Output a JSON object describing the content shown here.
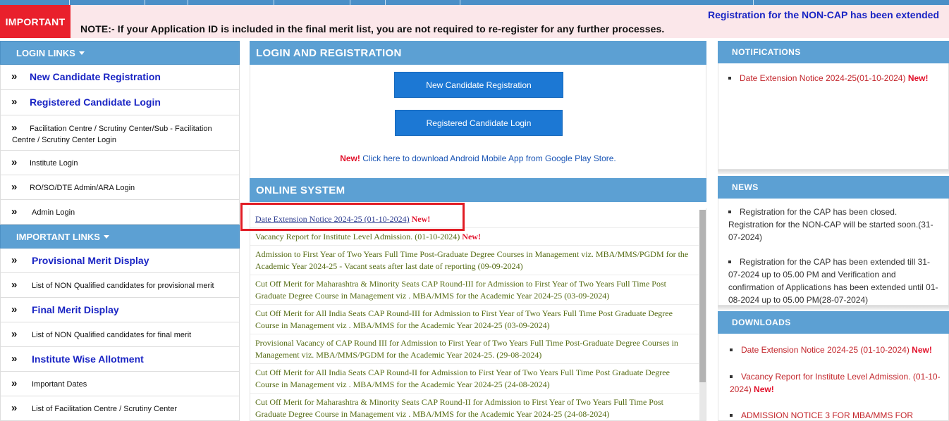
{
  "marquee_text": "Registration for the NON-CAP has been extended",
  "important_badge": "IMPORTANT",
  "note_text": "NOTE:- If your Application ID is included in the final merit list, you are not required to re-register for any further processes.",
  "login_links": {
    "heading": "LOGIN LINKS",
    "items": [
      "New Candidate Registration",
      "Registered Candidate Login",
      "Facilitation Centre / Scrutiny Center/Sub - Facilitation Centre / Scrutiny Center Login",
      "Institute Login",
      "RO/SO/DTE Admin/ARA Login",
      "Admin Login"
    ]
  },
  "important_links": {
    "heading": "IMPORTANT LINKS",
    "items": [
      "Provisional Merit Display",
      "List of NON Qualified candidates for provisional merit",
      "Final Merit Display",
      "List of NON Qualified candidates for final merit",
      "Institute Wise Allotment",
      "Important Dates",
      "List of Facilitation Centre / Scrutiny Center"
    ]
  },
  "login_registration": {
    "heading": "LOGIN AND REGISTRATION",
    "new_candidate_btn": "New Candidate Registration",
    "registered_login_btn": "Registered Candidate Login",
    "new_label": "New!",
    "app_text": "Click here to download Android Mobile App from Google Play Store."
  },
  "online_system": {
    "heading": "ONLINE SYSTEM",
    "new_label": "New!",
    "items": [
      "Date Extension Notice 2024-25 (01-10-2024)",
      "Vacancy Report for Institute Level Admission. (01-10-2024)",
      "Admission to First Year of Two Years Full Time Post-Graduate Degree Courses in Management viz. MBA/MMS/PGDM for the Academic Year 2024-25 - Vacant seats after last date of reporting (09-09-2024)",
      "Cut Off Merit for Maharashtra & Minority Seats CAP Round-III for Admission to First Year of Two Years Full Time Post Graduate Degree Course in Management viz . MBA/MMS for the Academic Year 2024-25 (03-09-2024)",
      "Cut Off Merit for All India Seats CAP Round-III for Admission to First Year of Two Years Full Time Post Graduate Degree Course in Management viz . MBA/MMS for the Academic Year 2024-25 (03-09-2024)",
      "Provisional Vacancy of CAP Round III for Admission to First Year of Two Years Full Time Post-Graduate Degree Courses in Management viz. MBA/MMS/PGDM for the Academic Year 2024-25. (29-08-2024)",
      "Cut Off Merit for All India Seats CAP Round-II for Admission to First Year of Two Years Full Time Post Graduate Degree Course in Management viz . MBA/MMS for the Academic Year 2024-25 (24-08-2024)",
      "Cut Off Merit for Maharashtra & Minority Seats CAP Round-II for Admission to First Year of Two Years Full Time Post Graduate Degree Course in Management viz . MBA/MMS for the Academic Year 2024-25 (24-08-2024)"
    ]
  },
  "notifications": {
    "heading": "NOTIFICATIONS",
    "items": [
      "Date Extension Notice 2024-25(01-10-2024)"
    ],
    "new_label": "New!"
  },
  "news": {
    "heading": "NEWS",
    "items": [
      "Registration for the CAP has been closed. Registration for the NON-CAP will be started soon.(31-07-2024)",
      "Registration for the CAP has been extended till 31-07-2024 up to 05.00 PM and Verification and confirmation of Applications has been extended until 01-08-2024 up to 05.00 PM(28-07-2024)"
    ]
  },
  "downloads": {
    "heading": "DOWNLOADS",
    "new_label": "New!",
    "items": [
      "Date Extension Notice 2024-25 (01-10-2024)",
      "Vacancy Report for Institute Level Admission. (01-10-2024)",
      "ADMISSION NOTICE 3 FOR MBA/MMS FOR"
    ]
  },
  "colors": {
    "header_blue": "#5ca0d3",
    "button_blue": "#1c78d4",
    "link_blue": "#1a25c4",
    "new_red": "#e2112b",
    "olive_text": "#556b13",
    "highlight_red": "#e11c24"
  }
}
